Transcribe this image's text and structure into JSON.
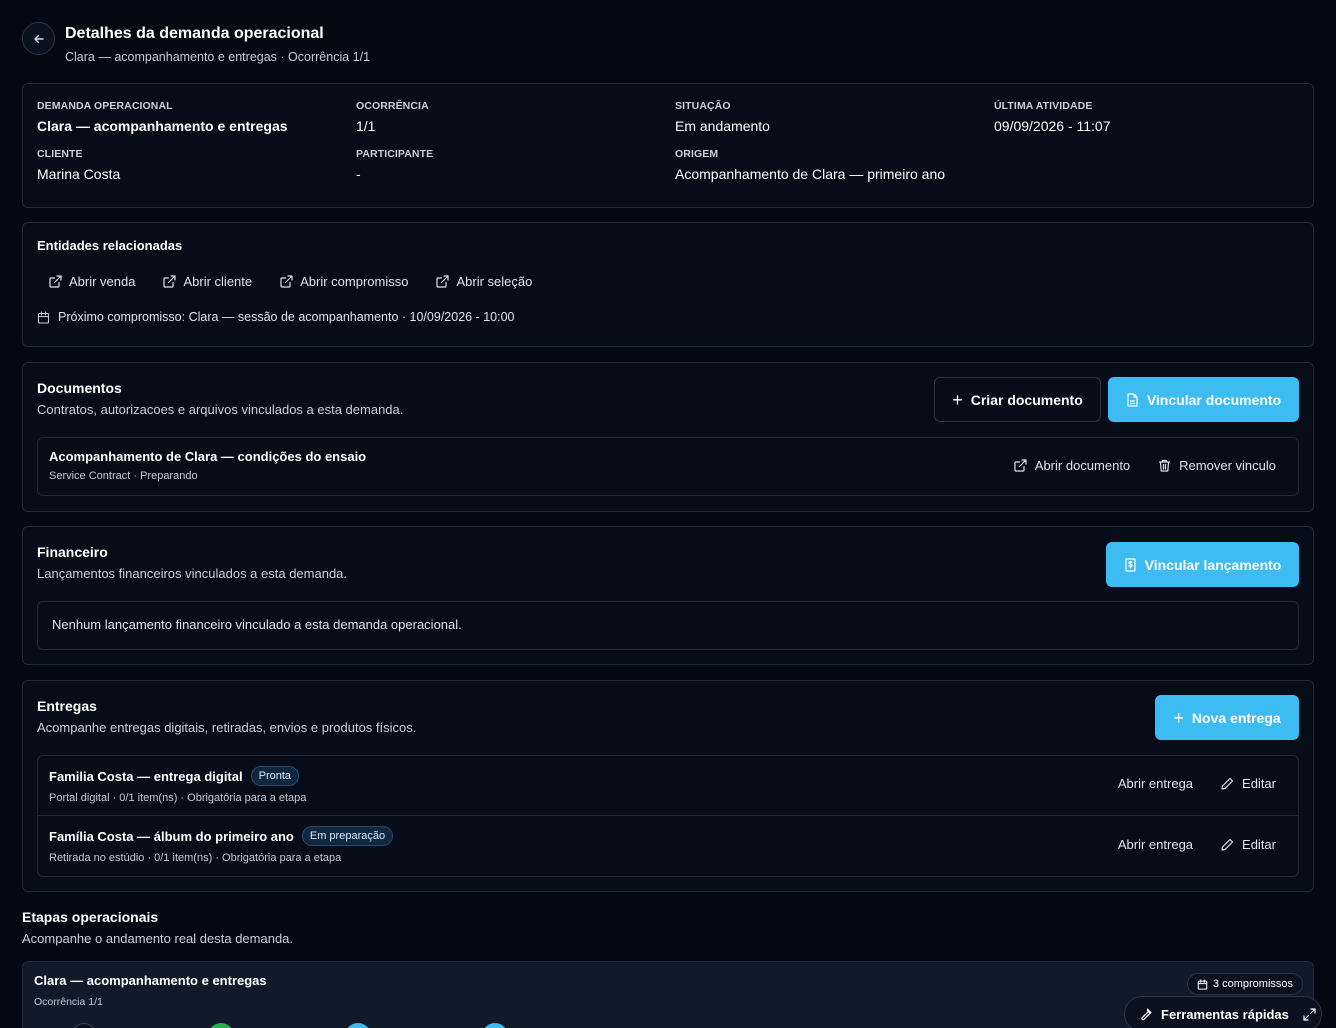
{
  "header": {
    "title": "Detalhes da demanda operacional",
    "subtitle": "Clara — acompanhamento e entregas · Ocorrência 1/1"
  },
  "summary": {
    "demand_label": "DEMANDA OPERACIONAL",
    "demand_value": "Clara — acompanhamento e entregas",
    "occurrence_label": "OCORRÊNCIA",
    "occurrence_value": "1/1",
    "status_label": "SITUAÇÃO",
    "status_value": "Em andamento",
    "last_activity_label": "ÚLTIMA ATIVIDADE",
    "last_activity_value": "09/09/2026 - 11:07",
    "client_label": "CLIENTE",
    "client_value": "Marina Costa",
    "participant_label": "PARTICIPANTE",
    "participant_value": "-",
    "origin_label": "ORIGEM",
    "origin_value": "Acompanhamento de Clara — primeiro ano"
  },
  "entities": {
    "title": "Entidades relacionadas",
    "links": [
      "Abrir venda",
      "Abrir cliente",
      "Abrir compromisso",
      "Abrir seleção"
    ],
    "next_appointment": "Próximo compromisso: Clara — sessão de acompanhamento · 10/09/2026 - 10:00"
  },
  "documents": {
    "title": "Documentos",
    "description": "Contratos, autorizacoes e arquivos vinculados a esta demanda.",
    "create_label": "Criar documento",
    "link_label": "Vincular documento",
    "item": {
      "title": "Acompanhamento de Clara — condições do ensaio",
      "meta": "Service Contract · Preparando",
      "open_label": "Abrir documento",
      "remove_label": "Remover vinculo"
    }
  },
  "financial": {
    "title": "Financeiro",
    "description": "Lançamentos financeiros vinculados a esta demanda.",
    "link_label": "Vincular lançamento",
    "empty": "Nenhum lançamento financeiro vinculado a esta demanda operacional."
  },
  "deliveries": {
    "title": "Entregas",
    "description": "Acompanhe entregas digitais, retiradas, envios e produtos físicos.",
    "new_label": "Nova entrega",
    "items": [
      {
        "title": "Familia Costa — entrega digital",
        "badge": "Pronta",
        "meta": "Portal digital · 0/1 item(ns) · Obrigatória para a etapa",
        "open_label": "Abrir entrega",
        "edit_label": "Editar"
      },
      {
        "title": "Família Costa — álbum do primeiro ano",
        "badge": "Em preparação",
        "meta": "Retirada no estúdio · 0/1 item(ns) · Obrigatória para a etapa",
        "open_label": "Abrir entrega",
        "edit_label": "Editar"
      }
    ]
  },
  "stages": {
    "title": "Etapas operacionais",
    "description": "Acompanhe o andamento real desta demanda.",
    "card_title": "Clara — acompanhamento e entregas",
    "card_occurrence": "Ocorrência 1/1",
    "appointments_badge": "3 compromissos"
  },
  "tools": {
    "label": "Ferramentas rápidas"
  },
  "colors": {
    "background": "#040813",
    "card": "#060c18",
    "border": "#1f2a3a",
    "accent": "#3cbcf0",
    "stage_done": "#22b14c"
  }
}
